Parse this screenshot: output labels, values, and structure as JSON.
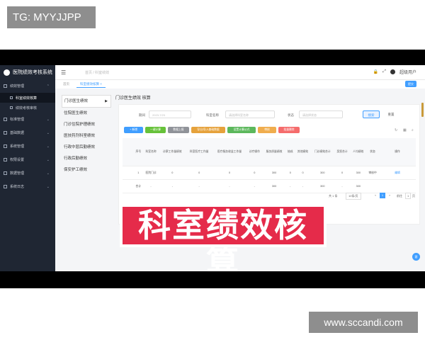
{
  "watermark": {
    "top_left": "TG: MYYJJPP",
    "bottom_right": "www.sccandi.com"
  },
  "app": {
    "title": "医院绩效考核系统"
  },
  "sidebar": {
    "items": [
      {
        "label": "绩效管理"
      },
      {
        "label": "科室绩效核算",
        "sub": true,
        "active": true
      },
      {
        "label": "绩效考核审核",
        "sub": true
      },
      {
        "label": "标准管理"
      },
      {
        "label": "基础数据"
      },
      {
        "label": "系统管理"
      },
      {
        "label": "权限设置"
      },
      {
        "label": "数据管理"
      },
      {
        "label": "系统日志"
      }
    ]
  },
  "header": {
    "breadcrumb": "首页 / 科室绩效",
    "user": "超级用户"
  },
  "tags": {
    "home": "首页",
    "current": "科室绩效核算",
    "close": "×",
    "top_btn": "提交"
  },
  "submenu": {
    "items": [
      {
        "label": "门诊医生绩效",
        "active": true
      },
      {
        "label": "住院医生绩效"
      },
      {
        "label": "门诊住院护理绩效"
      },
      {
        "label": "医技药剂科室绩效"
      },
      {
        "label": "行政中层后勤绩效"
      },
      {
        "label": "行政后勤绩效"
      },
      {
        "label": "保安护工绩效"
      }
    ],
    "arrow": "▶"
  },
  "panel": {
    "title": "门诊医生绩效 核算"
  },
  "filters": {
    "period_label": "期间",
    "period_placeholder": "2023-7/23",
    "dept_label": "科室名称",
    "dept_placeholder": "请选择科室名称",
    "status_label": "状态",
    "status_placeholder": "请选择状态",
    "search": "搜索",
    "reset": "重置"
  },
  "actions": [
    {
      "label": "+ 新增",
      "color": "#409eff"
    },
    {
      "label": "一键计算",
      "color": "#67c23a"
    },
    {
      "label": "数据上报",
      "color": "#909399"
    },
    {
      "label": "导出/导入基础数据",
      "color": "#e6a23c"
    },
    {
      "label": "设置计算公式",
      "color": "#5cb85c"
    },
    {
      "label": "审核",
      "color": "#f0ad4e"
    },
    {
      "label": "批量删除",
      "color": "#f56c6c"
    }
  ],
  "table": {
    "headers": [
      "",
      "序号",
      "科室名称",
      "诊察工作量绩效",
      "科室医疗工作量",
      "医疗服务收益工作量",
      "诊疗操作",
      "服务质量绩效",
      "抽成",
      "其他绩效",
      "门诊绩效合计",
      "奖惩合计",
      "人均绩效",
      "状态",
      "操作"
    ],
    "rows": [
      [
        "",
        "1",
        "医院门诊",
        "0",
        "0",
        "0",
        "0",
        "300",
        "0",
        "0",
        "300",
        "0",
        "300",
        "审核中",
        "编辑"
      ],
      [
        "",
        "合计",
        "-",
        "-",
        "-",
        "-",
        "-",
        "300",
        "-",
        "-",
        "300",
        "-",
        "300",
        "",
        ""
      ]
    ]
  },
  "pagination": {
    "total": "共 1 条",
    "page_size": "10条/页",
    "current": "1",
    "goto": "前往",
    "page": "1",
    "unit": "页"
  },
  "banner": "科室绩效核算",
  "float_btn": "客"
}
